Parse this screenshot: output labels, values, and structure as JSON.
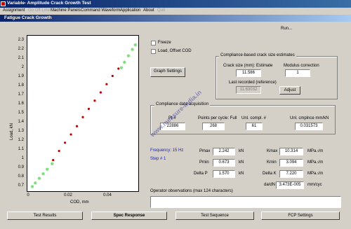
{
  "window": {
    "title": "Variable- Amplitude Crack Growth Test"
  },
  "menu": [
    {
      "label": "Assignment",
      "disabled": false
    },
    {
      "label": "Go Off-Line",
      "disabled": true
    },
    {
      "label": "Machine Panels",
      "disabled": false
    },
    {
      "label": "Command Waveform",
      "disabled": false
    },
    {
      "label": "Application",
      "disabled": false
    },
    {
      "label": "About",
      "disabled": false
    },
    {
      "label": "Quit",
      "disabled": true
    }
  ],
  "panel_title": "Fatigue Crack Growth",
  "run_status": "Run...",
  "plot": {
    "ylabel": "Load, kN",
    "xlabel": "COD, mm",
    "yticks": [
      "2.3",
      "2.2",
      "2.1",
      "2",
      "1.9",
      "1.8",
      "1.7",
      "1.6",
      "1.5",
      "1.4",
      "1.3",
      "1.2",
      "1.1",
      "1",
      "0.9",
      "0.8",
      "0.7"
    ],
    "xticks": [
      "0",
      "0.02",
      "0.04"
    ]
  },
  "chart_data": {
    "type": "scatter",
    "xlabel": "COD, mm",
    "ylabel": "Load, kN",
    "xlim": [
      -0.002,
      0.054
    ],
    "ylim": [
      0.65,
      2.35
    ],
    "series": [
      {
        "color": "#80e080",
        "x": [
          0.0005,
          0.002,
          0.004,
          0.006,
          0.008,
          0.0105,
          0.0455,
          0.047,
          0.049,
          0.051,
          0.0525
        ],
        "y": [
          0.7,
          0.74,
          0.79,
          0.84,
          0.89,
          0.95,
          2.0,
          2.06,
          2.13,
          2.2,
          2.25
        ]
      },
      {
        "color": "#c00000",
        "x": [
          0.011,
          0.014,
          0.017,
          0.02,
          0.023,
          0.026,
          0.029,
          0.032,
          0.035,
          0.038,
          0.041,
          0.044
        ],
        "y": [
          0.99,
          1.09,
          1.18,
          1.27,
          1.36,
          1.46,
          1.55,
          1.64,
          1.73,
          1.82,
          1.91,
          1.99
        ]
      }
    ]
  },
  "options": {
    "freeze": "Freeze",
    "load_offset": "Load, Offset COD",
    "graph_settings": "Graph Settings"
  },
  "compliance_group": {
    "title": "Compliance-based crack size estimates",
    "crack_size_label": "Crack size (mm): Estimate",
    "crack_size_value": "11.586",
    "modulus_label": "Modulus correction",
    "modulus_value": "1",
    "last_recorded_label": "Last recorded (reference)",
    "last_recorded_value": "11.63032",
    "adjust": "Adjust"
  },
  "acq_group": {
    "title": "Compliance data acquisition",
    "pt_label": "Pt #",
    "pt_value": "22886",
    "points_label": "Points per cycle: Full",
    "points_value": "268",
    "unl_label": "Unl. compl. #",
    "unl_value": "61",
    "cmp_label": "Unl. cmplnce mm/kN",
    "cmp_value": "0.031573"
  },
  "frequency": "Frequency: 15 Hz",
  "step": "Step # 1",
  "loads": [
    {
      "label": "Pmax",
      "value": "2.242",
      "unit": "kN"
    },
    {
      "label": "Pmin",
      "value": "0.673",
      "unit": "kN"
    },
    {
      "label": "Delta P",
      "value": "1.570",
      "unit": "kN"
    }
  ],
  "k_values": [
    {
      "label": "Kmax",
      "value": "10.314",
      "unit": "MPa.√m"
    },
    {
      "label": "Kmin",
      "value": "3.094",
      "unit": "MPa.√m"
    },
    {
      "label": "Delta K",
      "value": "7.220",
      "unit": "MPa.√m"
    },
    {
      "label": "da/dN",
      "value": "3.473E-005",
      "unit": "mm/cyc"
    }
  ],
  "observations_label": "Operator observations (max 124 characters)",
  "observations_value": "",
  "watermark": "www.measure-india.in",
  "tabs": [
    {
      "label": "Test Results",
      "active": false
    },
    {
      "label": "Spec Response",
      "active": true
    },
    {
      "label": "Test Sequence",
      "active": false
    },
    {
      "label": "FCP Settings",
      "active": false
    }
  ]
}
